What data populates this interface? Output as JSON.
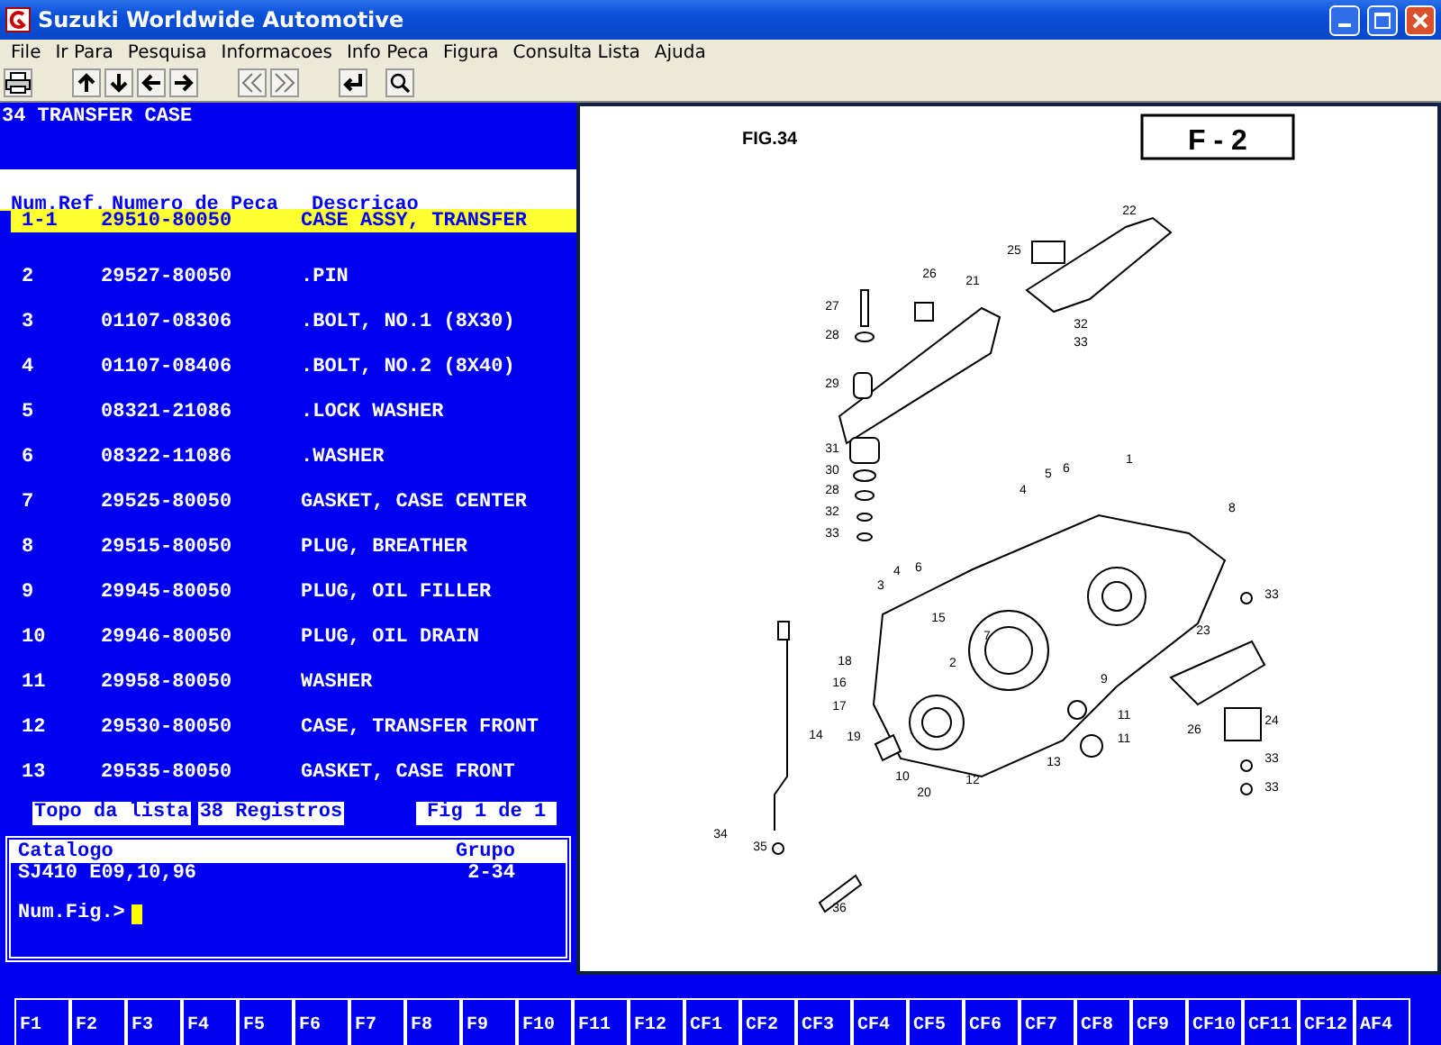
{
  "window": {
    "title": "Suzuki Worldwide Automotive"
  },
  "menu": [
    "File",
    "Ir Para",
    "Pesquisa",
    "Informacoes",
    "Info Peca",
    "Figura",
    "Consulta Lista",
    "Ajuda"
  ],
  "group_title": "34  TRANSFER CASE",
  "table": {
    "columns": [
      "Num.Ref.",
      "Numero de Peca",
      "Descricao"
    ],
    "rows": [
      {
        "ref": "1-1",
        "part": "29510-80050",
        "desc": "CASE ASSY, TRANSFER",
        "selected": true
      },
      {
        "ref": "2",
        "part": "29527-80050",
        "desc": ".PIN",
        "selected": false
      },
      {
        "ref": "3",
        "part": "01107-08306",
        "desc": ".BOLT, NO.1 (8X30)",
        "selected": false
      },
      {
        "ref": "4",
        "part": "01107-08406",
        "desc": ".BOLT, NO.2 (8X40)",
        "selected": false
      },
      {
        "ref": "5",
        "part": "08321-21086",
        "desc": ".LOCK WASHER",
        "selected": false
      },
      {
        "ref": "6",
        "part": "08322-11086",
        "desc": ".WASHER",
        "selected": false
      },
      {
        "ref": "7",
        "part": "29525-80050",
        "desc": "GASKET, CASE CENTER",
        "selected": false
      },
      {
        "ref": "8",
        "part": "29515-80050",
        "desc": "PLUG, BREATHER",
        "selected": false
      },
      {
        "ref": "9",
        "part": "29945-80050",
        "desc": "PLUG, OIL FILLER",
        "selected": false
      },
      {
        "ref": "10",
        "part": "29946-80050",
        "desc": "PLUG, OIL DRAIN",
        "selected": false
      },
      {
        "ref": "11",
        "part": "29958-80050",
        "desc": "WASHER",
        "selected": false
      },
      {
        "ref": "12",
        "part": "29530-80050",
        "desc": "CASE, TRANSFER FRONT",
        "selected": false
      },
      {
        "ref": "13",
        "part": "29535-80050",
        "desc": "GASKET, CASE FRONT",
        "selected": false
      }
    ]
  },
  "status": {
    "position": "Topo da lista",
    "count": "38 Registros",
    "figure": "Fig 1 de 1"
  },
  "catalog": {
    "catalog_label": "Catalogo",
    "catalog_value": "SJ410 E09,10,96",
    "group_label": "Grupo",
    "group_value": "2-34",
    "prompt": "Num.Fig.>"
  },
  "figure": {
    "title": "FIG.34",
    "code": "F - 2",
    "callouts": [
      "22",
      "25",
      "26",
      "21",
      "27",
      "28",
      "32",
      "33",
      "29",
      "31",
      "30",
      "28",
      "32",
      "33",
      "4",
      "5",
      "6",
      "1",
      "8",
      "3",
      "4",
      "6",
      "15",
      "7",
      "2",
      "18",
      "16",
      "17",
      "14",
      "19",
      "10",
      "20",
      "12",
      "13",
      "9",
      "11",
      "11",
      "26",
      "23",
      "33",
      "24",
      "33",
      "33",
      "34",
      "35",
      "36"
    ]
  },
  "function_keys": [
    "F1",
    "F2",
    "F3",
    "F4",
    "F5",
    "F6",
    "F7",
    "F8",
    "F9",
    "F10",
    "F11",
    "F12",
    "CF1",
    "CF2",
    "CF3",
    "CF4",
    "CF5",
    "CF6",
    "CF7",
    "CF8",
    "CF9",
    "CF10",
    "CF11",
    "CF12",
    "AF4"
  ]
}
